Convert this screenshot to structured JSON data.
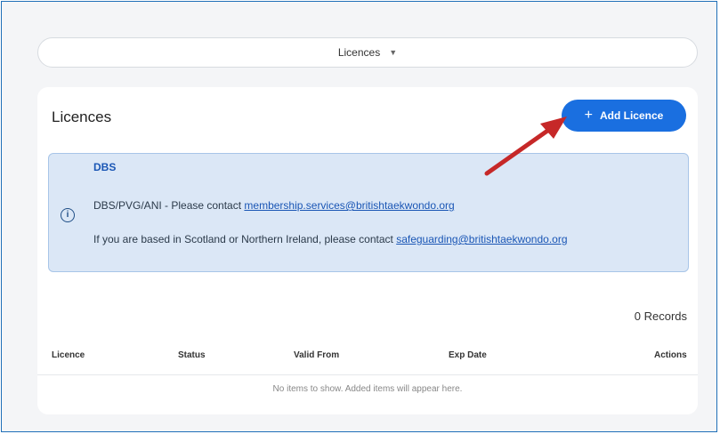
{
  "selector": {
    "label": "Licences"
  },
  "card": {
    "title": "Licences",
    "add_button_label": "Add Licence"
  },
  "banner": {
    "title": "DBS",
    "line1_prefix": "DBS/PVG/ANI - Please contact ",
    "line1_link": "membership.services@britishtaekwondo.org",
    "line2_prefix": "If you are based in Scotland or Northern Ireland, please contact ",
    "line2_link": "safeguarding@britishtaekwondo.org"
  },
  "table": {
    "records": "0 Records",
    "columns": [
      "Licence",
      "Status",
      "Valid From",
      "Exp Date",
      "Actions"
    ],
    "empty_text": "No items to show. Added items will appear here."
  },
  "colors": {
    "accent": "#1a6fe0",
    "annotation_arrow": "#c62828"
  },
  "icons": [
    "caret-down-icon",
    "plus-icon",
    "info-icon",
    "annotation-arrow"
  ]
}
